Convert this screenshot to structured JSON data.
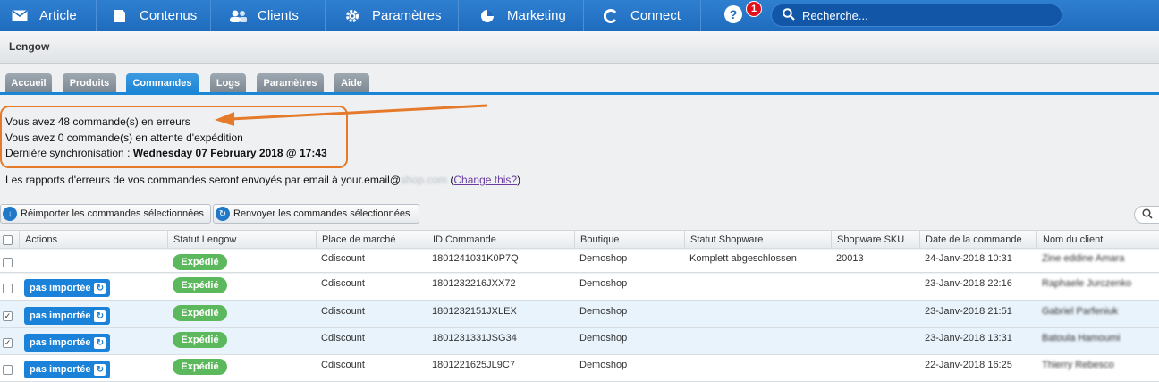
{
  "nav": {
    "items": [
      {
        "label": "Article",
        "icon": "mail-icon"
      },
      {
        "label": "Contenus",
        "icon": "document-icon"
      },
      {
        "label": "Clients",
        "icon": "users-icon"
      },
      {
        "label": "Paramètres",
        "icon": "gear-icon"
      },
      {
        "label": "Marketing",
        "icon": "pie-chart-icon"
      },
      {
        "label": "Connect",
        "icon": "connect-icon"
      }
    ],
    "help": "?",
    "notification_count": "1",
    "search_placeholder": "Recherche..."
  },
  "title": "Lengow",
  "tabs": [
    {
      "label": "Accueil",
      "active": false
    },
    {
      "label": "Produits",
      "active": false
    },
    {
      "label": "Commandes",
      "active": true
    },
    {
      "label": "Logs",
      "active": false
    },
    {
      "label": "Paramètres",
      "active": false
    },
    {
      "label": "Aide",
      "active": false
    }
  ],
  "info": {
    "errors": "Vous avez 48 commande(s) en erreurs",
    "pending": "Vous avez 0 commande(s) en attente d'expédition",
    "sync_label": "Dernière synchronisation : ",
    "sync_value": "Wednesday 07 February 2018 @ 17:43",
    "email_prefix": "Les rapports d'erreurs de vos commandes seront envoyés par email à your.email@",
    "email_blurred": "shop.com",
    "email_link": "Change this?"
  },
  "actions": {
    "reimport": "Réimporter les commandes sélectionnées",
    "resend": "Renvoyer les commandes sélectionnées"
  },
  "table": {
    "headers": [
      "Actions",
      "Statut Lengow",
      "Place de marché",
      "ID Commande",
      "Boutique",
      "Statut Shopware",
      "Shopware SKU",
      "Date de la commande",
      "Nom du client"
    ],
    "rows": [
      {
        "checked": false,
        "action": "",
        "status": "Expédié",
        "marketplace": "Cdiscount",
        "id": "1801241031K0P7Q",
        "shop": "Demoshop",
        "shopware_status": "Komplett abgeschlossen",
        "sku": "20013",
        "date": "24-Janv-2018 10:31",
        "client": "Zine eddine Amara"
      },
      {
        "checked": false,
        "action": "pas importée",
        "status": "Expédié",
        "marketplace": "Cdiscount",
        "id": "1801232216JXX72",
        "shop": "Demoshop",
        "shopware_status": "",
        "sku": "",
        "date": "23-Janv-2018 22:16",
        "client": "Raphaele Jurczenko"
      },
      {
        "checked": true,
        "action": "pas importée",
        "status": "Expédié",
        "marketplace": "Cdiscount",
        "id": "1801232151JXLEX",
        "shop": "Demoshop",
        "shopware_status": "",
        "sku": "",
        "date": "23-Janv-2018 21:51",
        "client": "Gabriel Parfeniuk"
      },
      {
        "checked": true,
        "action": "pas importée",
        "status": "Expédié",
        "marketplace": "Cdiscount",
        "id": "1801231331JSG34",
        "shop": "Demoshop",
        "shopware_status": "",
        "sku": "",
        "date": "23-Janv-2018 13:31",
        "client": "Batoula Hamoumi"
      },
      {
        "checked": false,
        "action": "pas importée",
        "status": "Expédié",
        "marketplace": "Cdiscount",
        "id": "1801221625JL9C7",
        "shop": "Demoshop",
        "shopware_status": "",
        "sku": "",
        "date": "22-Janv-2018 16:25",
        "client": "Thierry Rebesco"
      }
    ]
  },
  "colors": {
    "nav": "#1f6cbf",
    "tab_active": "#1c86d6",
    "badge": "#5cb85c",
    "highlight": "#e57b2a"
  }
}
